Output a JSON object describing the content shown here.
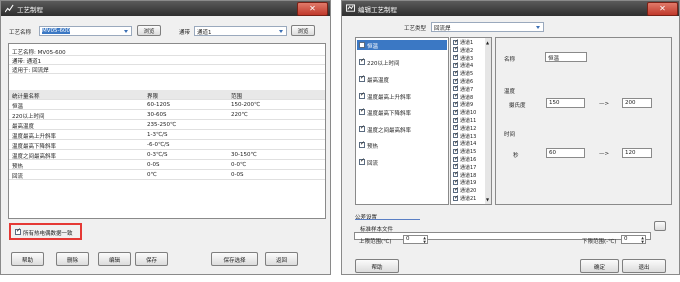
{
  "left": {
    "title": "工艺制程",
    "name_label": "工艺名称",
    "name_value": "MV05-600",
    "browse": "浏览",
    "channel_label": "通带",
    "channel_value": "通道1",
    "browse2": "浏览",
    "info": [
      "工艺名称: MV05-600",
      "通带: 通道1",
      "适用于: 回流焊"
    ],
    "table_headers": [
      "统计量名称",
      "界限",
      "范围"
    ],
    "rows": [
      [
        "恒温",
        "60-120S",
        "150-200℃"
      ],
      [
        "220以上时间",
        "30-60S",
        "220℃"
      ],
      [
        "最高温度",
        "235-250℃",
        ""
      ],
      [
        "温度最高上升斜率",
        "1-3℃/S",
        ""
      ],
      [
        "温度最高下降斜率",
        "-6-0℃/S",
        ""
      ],
      [
        "温度之间最高斜率",
        "0-3℃/S",
        "30-150℃"
      ],
      [
        "预热",
        "0-0S",
        "0-0℃"
      ],
      [
        "回流",
        "0℃",
        "0-0S"
      ]
    ],
    "highlight_check": "所有热电偶数据一致",
    "buttons": [
      "帮助",
      "删除",
      "编辑",
      "保存"
    ],
    "save_select": "保存选择",
    "back": "返回"
  },
  "right": {
    "title": "编辑工艺制程",
    "type_label": "工艺类型",
    "type_value": "回流焊",
    "stats": [
      "恒温",
      "220以上时间",
      "最高温度",
      "温度最高上升斜率",
      "温度最高下降斜率",
      "温度之间最高斜率",
      "预热",
      "回流"
    ],
    "channels": [
      "通道1",
      "通道2",
      "通道3",
      "通道4",
      "通道5",
      "通道6",
      "通道7",
      "通道8",
      "通道9",
      "通道10",
      "通道11",
      "通道12",
      "通道13",
      "通道14",
      "通道15",
      "通道16",
      "通道17",
      "通道18",
      "通道19",
      "通道20",
      "通道21"
    ],
    "name_label": "名称",
    "name_value": "恒温",
    "temp_label": "温度",
    "celsius_label": "摄氏度",
    "temp_min": "150",
    "arrow": "—>",
    "temp_max": "200",
    "time_label": "时间",
    "sec_label": "秒",
    "time_min": "60",
    "arrow2": "—>",
    "time_max": "120",
    "common_label": "公差设置",
    "std_file_label": "标准样本文件",
    "upper_label": "上限范围(℃)",
    "upper_val": "0",
    "lower_label": "下限范围(-℃)",
    "lower_val": "0",
    "help": "帮助",
    "ok": "确定",
    "cancel": "退出"
  },
  "colors": {
    "highlight": "#e53935",
    "accent": "#3b78c4"
  }
}
